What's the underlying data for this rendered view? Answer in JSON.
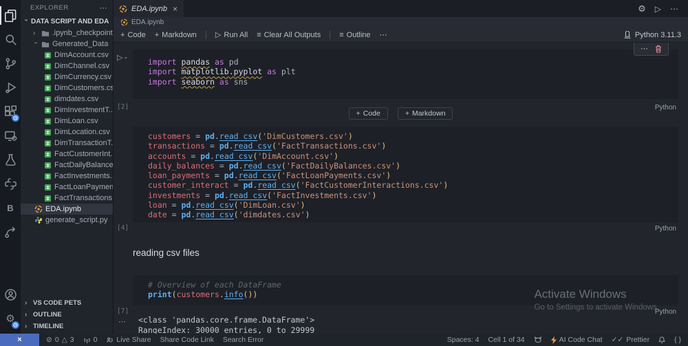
{
  "icons": {
    "plus": "+",
    "play": "▷",
    "run_chevron": "⌄",
    "chevron": "›",
    "more": "⋯",
    "menu": "≡",
    "gear": "⚙",
    "close": "×",
    "remote": "×",
    "error": "⊘",
    "warning": "△",
    "prettier_check": "✓✓",
    "braces": "{ }"
  },
  "activity_bar": {
    "icons": [
      "explorer",
      "search",
      "source-control",
      "run-and-debug",
      "extensions",
      "remote-explorer",
      "testing",
      "python",
      "bookmarks",
      "share",
      "account",
      "settings"
    ]
  },
  "sidebar": {
    "header": "EXPLORER",
    "section_title": "DATA SCRIPT AND EDA",
    "folder_checkpoints": ".ipynb_checkpoints",
    "folder_generated": "Generated_Data",
    "csv_files": [
      "DimAccount.csv",
      "DimChannel.csv",
      "DimCurrency.csv",
      "DimCustomers.csv",
      "dimdates.csv",
      "DimInvestmentT...",
      "DimLoan.csv",
      "DimLocation.csv",
      "DimTransactionT...",
      "FactCustomerInt...",
      "FactDailyBalance...",
      "FactInvestments....",
      "FactLoanPaymen...",
      "FactTransactions...."
    ],
    "notebook_file": "EDA.ipynb",
    "script_file": "generate_script.py",
    "panels": [
      "VS CODE PETS",
      "OUTLINE",
      "TIMELINE"
    ]
  },
  "editor": {
    "tab_title": "EDA.ipynb",
    "breadcrumb": "EDA.ipynb",
    "toolbar": {
      "code": "Code",
      "markdown": "Markdown",
      "run_all": "Run All",
      "clear_outputs": "Clear All Outputs",
      "outline": "Outline"
    },
    "kernel": "Python 3.11.3"
  },
  "cells": [
    {
      "exec": "[2]",
      "lang": "Python",
      "lines": [
        [
          [
            "kw",
            "import"
          ],
          [
            "txt",
            " "
          ],
          [
            "mod",
            "pandas"
          ],
          [
            "txt",
            " "
          ],
          [
            "kw",
            "as"
          ],
          [
            "txt",
            " "
          ],
          [
            "txt",
            "pd"
          ]
        ],
        [
          [
            "kw",
            "import"
          ],
          [
            "txt",
            " "
          ],
          [
            "mod",
            "matplotlib.pyplot"
          ],
          [
            "txt",
            " "
          ],
          [
            "kw",
            "as"
          ],
          [
            "txt",
            " "
          ],
          [
            "txt",
            "plt"
          ]
        ],
        [
          [
            "kw",
            "import"
          ],
          [
            "txt",
            " "
          ],
          [
            "mod",
            "seaborn"
          ],
          [
            "txt",
            " "
          ],
          [
            "kw",
            "as"
          ],
          [
            "txt",
            " "
          ],
          [
            "txt",
            "sns"
          ]
        ]
      ]
    },
    {
      "exec": "[4]",
      "lang": "Python",
      "lines": [
        [
          [
            "var",
            "customers"
          ],
          [
            "op",
            " = "
          ],
          [
            "lib",
            "pd"
          ],
          [
            "txt",
            "."
          ],
          [
            "fn",
            "read_csv"
          ],
          [
            "punc",
            "("
          ],
          [
            "str",
            "'DimCustomers.csv'"
          ],
          [
            "punc",
            ")"
          ]
        ],
        [
          [
            "var",
            "transactions"
          ],
          [
            "op",
            " = "
          ],
          [
            "lib",
            "pd"
          ],
          [
            "txt",
            "."
          ],
          [
            "fn",
            "read_csv"
          ],
          [
            "punc",
            "("
          ],
          [
            "str",
            "'FactTransactions.csv'"
          ],
          [
            "punc",
            ")"
          ]
        ],
        [
          [
            "var",
            "accounts"
          ],
          [
            "op",
            " = "
          ],
          [
            "lib",
            "pd"
          ],
          [
            "txt",
            "."
          ],
          [
            "fn",
            "read_csv"
          ],
          [
            "punc",
            "("
          ],
          [
            "str",
            "'DimAccount.csv'"
          ],
          [
            "punc",
            ")"
          ]
        ],
        [
          [
            "var",
            "daily_balances"
          ],
          [
            "op",
            " = "
          ],
          [
            "lib",
            "pd"
          ],
          [
            "txt",
            "."
          ],
          [
            "fn",
            "read_csv"
          ],
          [
            "punc",
            "("
          ],
          [
            "str",
            "'FactDailyBalances.csv'"
          ],
          [
            "punc",
            ")"
          ]
        ],
        [
          [
            "var",
            "loan_payments"
          ],
          [
            "op",
            " = "
          ],
          [
            "lib",
            "pd"
          ],
          [
            "txt",
            "."
          ],
          [
            "fn",
            "read_csv"
          ],
          [
            "punc",
            "("
          ],
          [
            "str",
            "'FactLoanPayments.csv'"
          ],
          [
            "punc",
            ")"
          ]
        ],
        [
          [
            "var",
            "customer_interact"
          ],
          [
            "op",
            " = "
          ],
          [
            "lib",
            "pd"
          ],
          [
            "txt",
            "."
          ],
          [
            "fn",
            "read_csv"
          ],
          [
            "punc",
            "("
          ],
          [
            "str",
            "'FactCustomerInteractions.csv'"
          ],
          [
            "punc",
            ")"
          ]
        ],
        [
          [
            "var",
            "investments"
          ],
          [
            "op",
            " = "
          ],
          [
            "lib",
            "pd"
          ],
          [
            "txt",
            "."
          ],
          [
            "fn",
            "read_csv"
          ],
          [
            "punc",
            "("
          ],
          [
            "str",
            "'FactInvestments.csv'"
          ],
          [
            "punc",
            ")"
          ]
        ],
        [
          [
            "var",
            "loan"
          ],
          [
            "op",
            " = "
          ],
          [
            "lib",
            "pd"
          ],
          [
            "txt",
            "."
          ],
          [
            "fn",
            "read_csv"
          ],
          [
            "punc",
            "("
          ],
          [
            "str",
            "'DimLoan.csv'"
          ],
          [
            "punc",
            ")"
          ]
        ],
        [
          [
            "var",
            "date"
          ],
          [
            "op",
            " = "
          ],
          [
            "lib",
            "pd"
          ],
          [
            "txt",
            "."
          ],
          [
            "fn",
            "read_csv"
          ],
          [
            "punc",
            "("
          ],
          [
            "str",
            "'dimdates.csv'"
          ],
          [
            "punc",
            ")"
          ]
        ]
      ]
    },
    {
      "markdown": "reading csv files"
    },
    {
      "exec": "[7]",
      "lang": "Python",
      "lines": [
        [
          [
            "cmt",
            "# Overview of each DataFrame"
          ]
        ],
        [
          [
            "lib",
            "print"
          ],
          [
            "punc",
            "("
          ],
          [
            "var",
            "customers"
          ],
          [
            "txt",
            "."
          ],
          [
            "fn",
            "info"
          ],
          [
            "punc",
            "())"
          ]
        ]
      ]
    }
  ],
  "output": {
    "lines": [
      "<class 'pandas.core.frame.DataFrame'>",
      "RangeIndex: 30000 entries, 0 to 29999"
    ]
  },
  "watermark": {
    "line1": "Activate Windows",
    "line2": "Go to Settings to activate Windows."
  },
  "status_bar": {
    "errors": "0",
    "warnings": "3",
    "ports": "0",
    "live_share": "Live Share",
    "share_code_link": "Share Code Link",
    "search_error": "Search Error",
    "spaces": "Spaces: 4",
    "cell_position": "Cell 1 of 34",
    "ai_code_chat": "AI Code Chat",
    "prettier": "Prettier"
  }
}
